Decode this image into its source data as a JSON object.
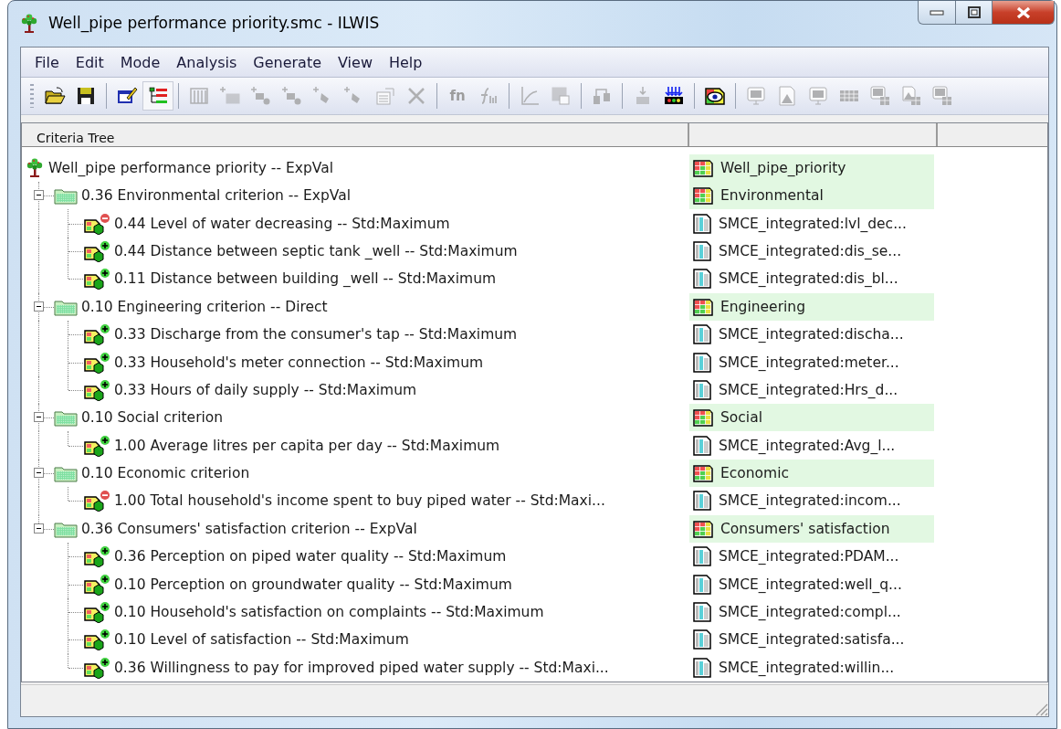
{
  "window": {
    "title": "Well_pipe performance priority.smc - ILWIS"
  },
  "menu": [
    "File",
    "Edit",
    "Mode",
    "Analysis",
    "Generate",
    "View",
    "Help"
  ],
  "toolbar": [
    [
      {
        "kind": "open",
        "disabled": false,
        "selected": false
      },
      {
        "kind": "save",
        "disabled": false,
        "selected": false
      }
    ],
    [
      {
        "kind": "edit-table",
        "disabled": false,
        "selected": false
      },
      {
        "kind": "tree-view",
        "disabled": false,
        "selected": true
      }
    ],
    [
      {
        "kind": "columns",
        "disabled": true,
        "selected": false
      },
      {
        "kind": "add-map",
        "disabled": true,
        "selected": false
      },
      {
        "kind": "add-link",
        "disabled": true,
        "selected": false
      },
      {
        "kind": "add-link",
        "disabled": true,
        "selected": false
      },
      {
        "kind": "add-point",
        "disabled": true,
        "selected": false
      },
      {
        "kind": "add-point",
        "disabled": true,
        "selected": false
      },
      {
        "kind": "properties",
        "disabled": true,
        "selected": false
      },
      {
        "kind": "delete",
        "disabled": true,
        "selected": false
      }
    ],
    [
      {
        "kind": "text",
        "label": "fn",
        "disabled": true,
        "selected": false
      },
      {
        "kind": "function-crossed",
        "disabled": true,
        "selected": false
      }
    ],
    [
      {
        "kind": "graph",
        "disabled": true,
        "selected": false
      },
      {
        "kind": "map-chart",
        "disabled": true,
        "selected": false
      }
    ],
    [
      {
        "kind": "tool",
        "disabled": true,
        "selected": false
      }
    ],
    [
      {
        "kind": "import",
        "disabled": true,
        "selected": false
      },
      {
        "kind": "arrows",
        "disabled": false,
        "selected": false
      }
    ],
    [
      {
        "kind": "eye",
        "disabled": false,
        "selected": false
      }
    ],
    [
      {
        "kind": "monitor",
        "disabled": true,
        "selected": false
      },
      {
        "kind": "image",
        "disabled": true,
        "selected": false
      },
      {
        "kind": "monitor",
        "disabled": true,
        "selected": false
      },
      {
        "kind": "grid",
        "disabled": true,
        "selected": false
      },
      {
        "kind": "monitor-grid",
        "disabled": true,
        "selected": false
      },
      {
        "kind": "image-grid",
        "disabled": true,
        "selected": false
      },
      {
        "kind": "monitor-grid",
        "disabled": true,
        "selected": false
      }
    ]
  ],
  "table": {
    "columns": [
      "Criteria Tree"
    ],
    "tree": {
      "kind": "goal",
      "label": "Well_pipe performance priority -- ExpVal",
      "output": {
        "kind": "map",
        "label": "Well_pipe_priority"
      },
      "children": [
        {
          "kind": "group",
          "label": "0.36 Environmental criterion -- ExpVal",
          "expanded": true,
          "output": {
            "kind": "map",
            "label": "Environmental"
          },
          "children": [
            {
              "kind": "criterion",
              "cost": true,
              "label": "0.44 Level of water decreasing -- Std:Maximum",
              "output": {
                "kind": "attribute",
                "label": "SMCE_integrated:lvl_dec..."
              }
            },
            {
              "kind": "criterion",
              "cost": false,
              "label": "0.44 Distance between septic tank _well -- Std:Maximum",
              "output": {
                "kind": "attribute",
                "label": "SMCE_integrated:dis_se..."
              }
            },
            {
              "kind": "criterion",
              "cost": false,
              "label": "0.11 Distance between building _well -- Std:Maximum",
              "output": {
                "kind": "attribute",
                "label": "SMCE_integrated:dis_bl..."
              }
            }
          ]
        },
        {
          "kind": "group",
          "label": "0.10 Engineering criterion -- Direct",
          "expanded": true,
          "output": {
            "kind": "map",
            "label": "Engineering"
          },
          "children": [
            {
              "kind": "criterion",
              "cost": false,
              "label": "0.33 Discharge from the consumer's tap -- Std:Maximum",
              "output": {
                "kind": "attribute",
                "label": "SMCE_integrated:discha..."
              }
            },
            {
              "kind": "criterion",
              "cost": false,
              "label": "0.33 Household's meter connection -- Std:Maximum",
              "output": {
                "kind": "attribute",
                "label": "SMCE_integrated:meter..."
              }
            },
            {
              "kind": "criterion",
              "cost": false,
              "label": "0.33 Hours of daily supply -- Std:Maximum",
              "output": {
                "kind": "attribute",
                "label": "SMCE_integrated:Hrs_d..."
              }
            }
          ]
        },
        {
          "kind": "group",
          "label": "0.10 Social criterion",
          "expanded": true,
          "output": {
            "kind": "map",
            "label": "Social"
          },
          "children": [
            {
              "kind": "criterion",
              "cost": false,
              "label": "1.00 Average litres per capita per day -- Std:Maximum",
              "output": {
                "kind": "attribute",
                "label": "SMCE_integrated:Avg_l..."
              }
            }
          ]
        },
        {
          "kind": "group",
          "label": "0.10 Economic criterion",
          "expanded": true,
          "output": {
            "kind": "map",
            "label": "Economic"
          },
          "children": [
            {
              "kind": "criterion",
              "cost": true,
              "label": "1.00 Total household's income spent to buy piped water -- Std:Maxi...",
              "output": {
                "kind": "attribute",
                "label": "SMCE_integrated:incom..."
              }
            }
          ]
        },
        {
          "kind": "group",
          "label": "0.36 Consumers' satisfaction criterion -- ExpVal",
          "expanded": true,
          "output": {
            "kind": "map",
            "label": "Consumers' satisfaction"
          },
          "children": [
            {
              "kind": "criterion",
              "cost": false,
              "label": "0.36 Perception on piped water quality -- Std:Maximum",
              "output": {
                "kind": "attribute",
                "label": "SMCE_integrated:PDAM..."
              }
            },
            {
              "kind": "criterion",
              "cost": false,
              "label": "0.10 Perception on groundwater quality -- Std:Maximum",
              "output": {
                "kind": "attribute",
                "label": "SMCE_integrated:well_q..."
              }
            },
            {
              "kind": "criterion",
              "cost": false,
              "label": "0.10 Household's satisfaction on complaints -- Std:Maximum",
              "output": {
                "kind": "attribute",
                "label": "SMCE_integrated:compl..."
              }
            },
            {
              "kind": "criterion",
              "cost": false,
              "label": "0.10 Level of satisfaction -- Std:Maximum",
              "output": {
                "kind": "attribute",
                "label": "SMCE_integrated:satisfa..."
              }
            },
            {
              "kind": "criterion",
              "cost": false,
              "label": "0.36 Willingness to pay for improved piped water supply -- Std:Maxi...",
              "output": {
                "kind": "attribute",
                "label": "SMCE_integrated:willin..."
              }
            }
          ]
        }
      ]
    }
  }
}
